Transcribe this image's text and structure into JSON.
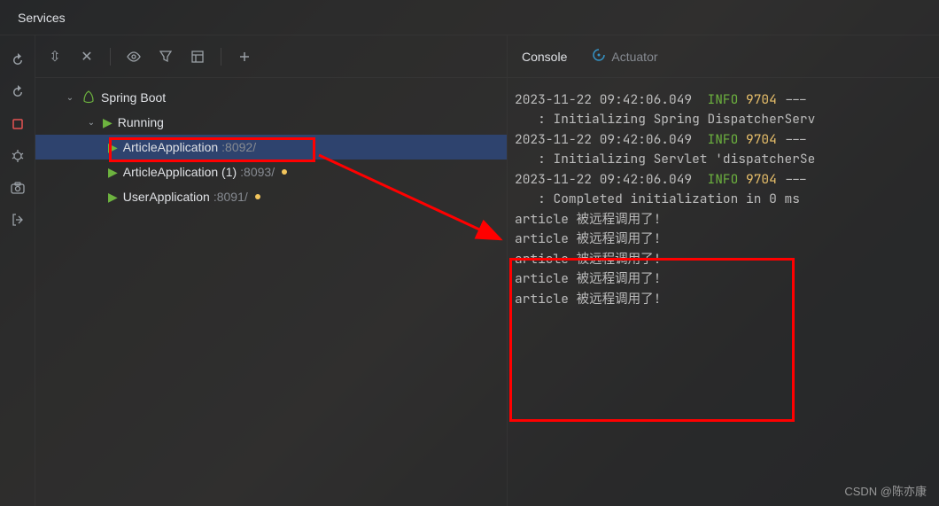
{
  "header": {
    "title": "Services"
  },
  "tree": {
    "root": "Spring Boot",
    "group": "Running",
    "apps": [
      {
        "name": "ArticleApplication",
        "port": ":8092/",
        "selected": true,
        "warn": false
      },
      {
        "name": "ArticleApplication (1)",
        "port": ":8093/",
        "selected": false,
        "warn": true
      },
      {
        "name": "UserApplication",
        "port": ":8091/",
        "selected": false,
        "warn": true
      }
    ]
  },
  "tabs": {
    "console": "Console",
    "actuator": "Actuator"
  },
  "log": {
    "lines": [
      {
        "ts": "2023-11-22 09:42:06.049",
        "level": "INFO",
        "pid": "9704",
        "dash": "---"
      },
      {
        "msg": "   : Initializing Spring DispatcherServ"
      },
      {
        "ts": "2023-11-22 09:42:06.049",
        "level": "INFO",
        "pid": "9704",
        "dash": "---"
      },
      {
        "msg": "   : Initializing Servlet 'dispatcherSe"
      },
      {
        "ts": "2023-11-22 09:42:06.049",
        "level": "INFO",
        "pid": "9704",
        "dash": "---"
      },
      {
        "msg": "   : Completed initialization in 0 ms"
      }
    ],
    "calls": [
      "article 被远程调用了!",
      "article 被远程调用了!",
      "article 被远程调用了!",
      "article 被远程调用了!",
      "article 被远程调用了!"
    ]
  },
  "watermark": "CSDN @陈亦康"
}
